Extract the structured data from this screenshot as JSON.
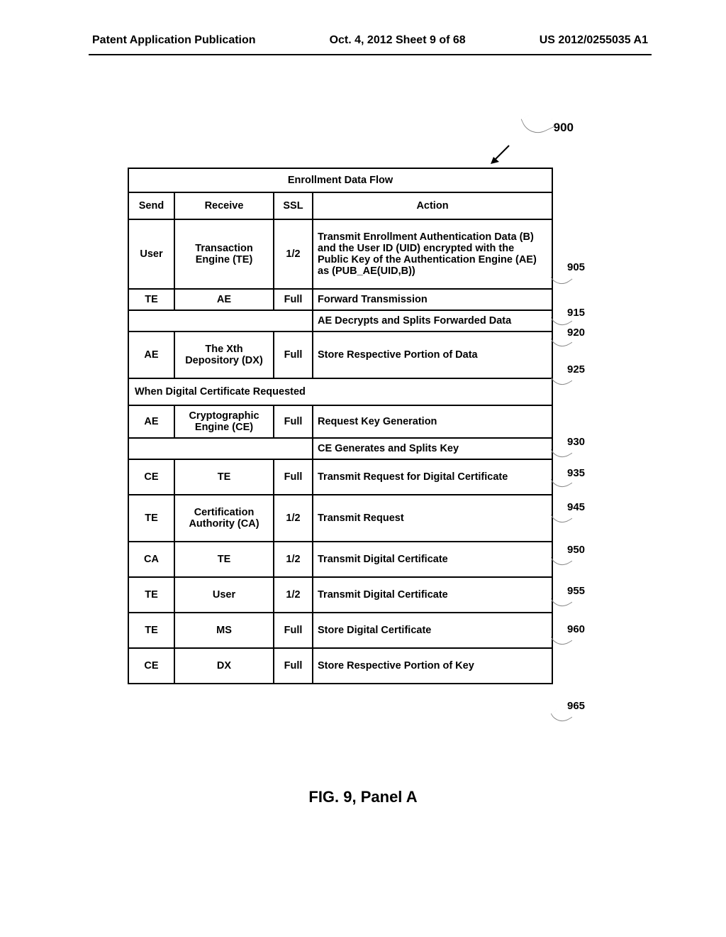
{
  "header": {
    "left": "Patent Application Publication",
    "center": "Oct. 4, 2012   Sheet 9 of 68",
    "right": "US 2012/0255035 A1"
  },
  "figureNumber": "900",
  "table": {
    "title": "Enrollment Data Flow",
    "columns": {
      "send": "Send",
      "receive": "Receive",
      "ssl": "SSL",
      "action": "Action"
    },
    "rows": [
      {
        "send": "User",
        "receive": "Transaction Engine (TE)",
        "ssl": "1/2",
        "action": "Transmit Enrollment Authentication Data (B) and the User ID (UID) encrypted with the Public Key of the Authentication Engine (AE) as (PUB_AE(UID,B))"
      },
      {
        "send": "TE",
        "receive": "AE",
        "ssl": "Full",
        "action": "Forward Transmission"
      },
      {
        "merged": true,
        "action": "AE Decrypts and Splits Forwarded Data"
      },
      {
        "send": "AE",
        "receive": "The Xth Depository (DX)",
        "ssl": "Full",
        "action": "Store Respective Portion of Data"
      }
    ],
    "sectionHeader": "When Digital Certificate Requested",
    "rows2": [
      {
        "send": "AE",
        "receive": "Cryptographic Engine (CE)",
        "ssl": "Full",
        "action": "Request Key Generation"
      },
      {
        "merged": true,
        "action": "CE Generates and Splits Key"
      },
      {
        "send": "CE",
        "receive": "TE",
        "ssl": "Full",
        "action": "Transmit Request for Digital Certificate"
      },
      {
        "send": "TE",
        "receive": "Certification Authority (CA)",
        "ssl": "1/2",
        "action": "Transmit Request"
      },
      {
        "send": "CA",
        "receive": "TE",
        "ssl": "1/2",
        "action": "Transmit Digital Certificate"
      },
      {
        "send": "TE",
        "receive": "User",
        "ssl": "1/2",
        "action": "Transmit Digital Certificate"
      },
      {
        "send": "TE",
        "receive": "MS",
        "ssl": "Full",
        "action": "Store Digital Certificate"
      },
      {
        "send": "CE",
        "receive": "DX",
        "ssl": "Full",
        "action": "Store Respective Portion of Key"
      }
    ]
  },
  "callouts": {
    "c905": "905",
    "c915": "915",
    "c920": "920",
    "c925": "925",
    "c930": "930",
    "c935": "935",
    "c945": "945",
    "c950": "950",
    "c955": "955",
    "c960": "960",
    "c965": "965"
  },
  "caption": "FIG. 9, Panel A"
}
